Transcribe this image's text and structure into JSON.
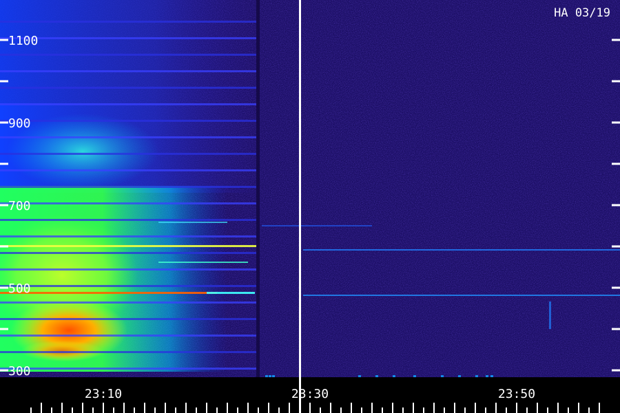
{
  "chart_data": {
    "type": "heatmap",
    "title": "HA 03/19",
    "xlabel": "",
    "ylabel": "",
    "x_tick_labels": [
      "23:10",
      "23:30",
      "23:50"
    ],
    "y_tick_labels": [
      "300",
      "500",
      "700",
      "900",
      "1100"
    ],
    "ylim": [
      300,
      1100
    ],
    "x_range": [
      "23:03",
      "23:58"
    ],
    "marker_time": "23:30",
    "colormap": [
      "#1a0a5a",
      "#2a1aa8",
      "#1030ff",
      "#00b0ff",
      "#00ffd0",
      "#40ff40",
      "#d0ff20",
      "#ffb000",
      "#ff4000"
    ],
    "grid": false,
    "legend": "none"
  }
}
